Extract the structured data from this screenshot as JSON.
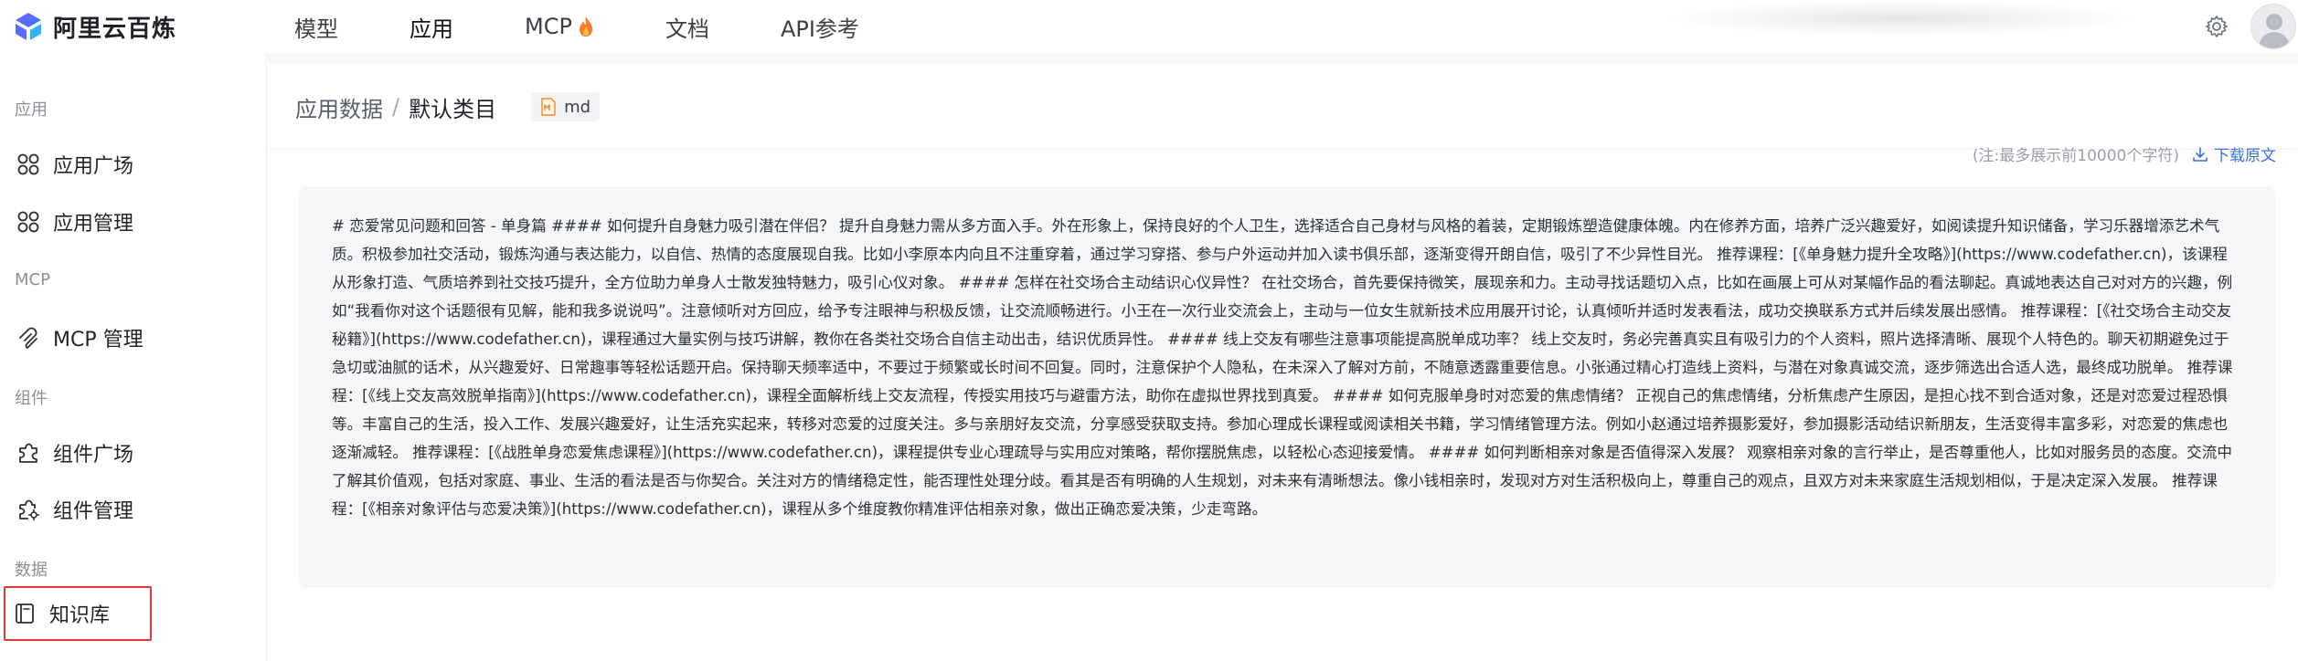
{
  "brand": {
    "name": "阿里云百炼"
  },
  "nav": {
    "items": [
      {
        "label": "模型"
      },
      {
        "label": "应用"
      },
      {
        "label": "MCP"
      },
      {
        "label": "文档"
      },
      {
        "label": "API参考"
      }
    ],
    "mcp_badge_icon": "flame-icon"
  },
  "sidebar": {
    "sections": {
      "app": "应用",
      "mcp": "MCP",
      "components": "组件",
      "data": "数据"
    },
    "items": [
      {
        "label": "应用广场",
        "icon": "grid-icon"
      },
      {
        "label": "应用管理",
        "icon": "grid-icon"
      },
      {
        "label": "MCP 管理",
        "icon": "mcp-icon"
      },
      {
        "label": "组件广场",
        "icon": "puzzle-icon"
      },
      {
        "label": "组件管理",
        "icon": "puzzle-gear-icon"
      },
      {
        "label": "知识库",
        "icon": "book-icon"
      }
    ],
    "selected_highlight_color": "#e23a3a"
  },
  "breadcrumb": {
    "parent": "应用数据",
    "separator": "/",
    "current": "默认类目",
    "tag": "md"
  },
  "toolbar": {
    "note": "(注:最多展示前10000个字符)",
    "download_label": "下载原文"
  },
  "document": {
    "text": "# 恋爱常见问题和回答 - 单身篇 #### 如何提升自身魅力吸引潜在伴侣？ 提升自身魅力需从多方面入手。外在形象上，保持良好的个人卫生，选择适合自己身材与风格的着装，定期锻炼塑造健康体魄。内在修养方面，培养广泛兴趣爱好，如阅读提升知识储备，学习乐器增添艺术气质。积极参加社交活动，锻炼沟通与表达能力，以自信、热情的态度展现自我。比如小李原本内向且不注重穿着，通过学习穿搭、参与户外运动并加入读书俱乐部，逐渐变得开朗自信，吸引了不少异性目光。 推荐课程：[《单身魅力提升全攻略》](https://www.codefather.cn)，该课程从形象打造、气质培养到社交技巧提升，全方位助力单身人士散发独特魅力，吸引心仪对象。 #### 怎样在社交场合主动结识心仪异性？ 在社交场合，首先要保持微笑，展现亲和力。主动寻找话题切入点，比如在画展上可从对某幅作品的看法聊起。真诚地表达自己对对方的兴趣，例如“我看你对这个话题很有见解，能和我多说说吗”。注意倾听对方回应，给予专注眼神与积极反馈，让交流顺畅进行。小王在一次行业交流会上，主动与一位女生就新技术应用展开讨论，认真倾听并适时发表看法，成功交换联系方式并后续发展出感情。 推荐课程：[《社交场合主动交友秘籍》](https://www.codefather.cn)，课程通过大量实例与技巧讲解，教你在各类社交场合自信主动出击，结识优质异性。 #### 线上交友有哪些注意事项能提高脱单成功率？ 线上交友时，务必完善真实且有吸引力的个人资料，照片选择清晰、展现个人特色的。聊天初期避免过于急切或油腻的话术，从兴趣爱好、日常趣事等轻松话题开启。保持聊天频率适中，不要过于频繁或长时间不回复。同时，注意保护个人隐私，在未深入了解对方前，不随意透露重要信息。小张通过精心打造线上资料，与潜在对象真诚交流，逐步筛选出合适人选，最终成功脱单。 推荐课程：[《线上交友高效脱单指南》](https://www.codefather.cn)，课程全面解析线上交友流程，传授实用技巧与避雷方法，助你在虚拟世界找到真爱。 #### 如何克服单身时对恋爱的焦虑情绪？ 正视自己的焦虑情绪，分析焦虑产生原因，是担心找不到合适对象，还是对恋爱过程恐惧等。丰富自己的生活，投入工作、发展兴趣爱好，让生活充实起来，转移对恋爱的过度关注。多与亲朋好友交流，分享感受获取支持。参加心理成长课程或阅读相关书籍，学习情绪管理方法。例如小赵通过培养摄影爱好，参加摄影活动结识新朋友，生活变得丰富多彩，对恋爱的焦虑也逐渐减轻。 推荐课程：[《战胜单身恋爱焦虑课程》](https://www.codefather.cn)，课程提供专业心理疏导与实用应对策略，帮你摆脱焦虑，以轻松心态迎接爱情。 #### 如何判断相亲对象是否值得深入发展？ 观察相亲对象的言行举止，是否尊重他人，比如对服务员的态度。交流中了解其价值观，包括对家庭、事业、生活的看法是否与你契合。关注对方的情绪稳定性，能否理性处理分歧。看其是否有明确的人生规划，对未来有清晰想法。像小钱相亲时，发现对方对生活积极向上，尊重自己的观点，且双方对未来家庭生活规划相似，于是决定深入发展。 推荐课程：[《相亲对象评估与恋爱决策》](https://www.codefather.cn)，课程从多个维度教你精准评估相亲对象，做出正确恋爱决策，少走弯路。"
  },
  "colors": {
    "accent_link": "#3a6fe2",
    "text_box_bg": "#f5f6f8",
    "page_bg": "#f7f8fa"
  }
}
